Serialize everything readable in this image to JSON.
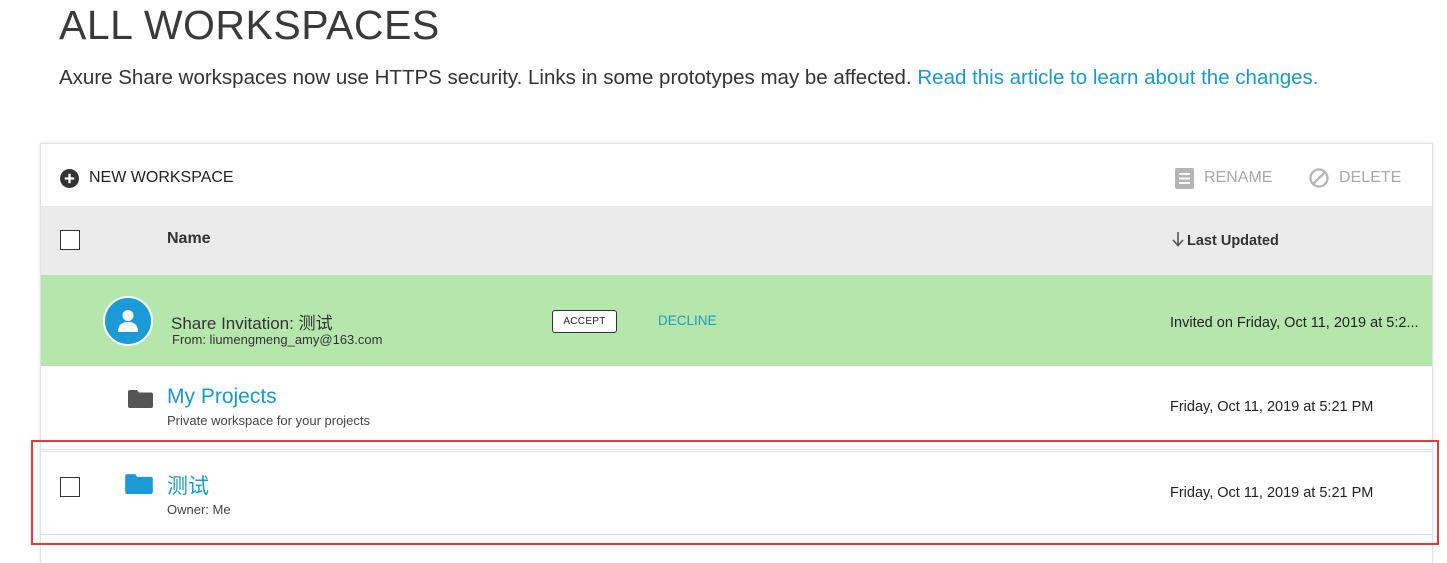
{
  "page": {
    "title": "ALL WORKSPACES",
    "notice_text": "Axure Share workspaces now use HTTPS security. Links in some prototypes may be affected.",
    "notice_link": "Read this article to learn about the changes."
  },
  "toolbar": {
    "new_workspace": "NEW WORKSPACE",
    "rename": "RENAME",
    "delete": "DELETE"
  },
  "table": {
    "header_name": "Name",
    "header_last_updated": "Last Updated",
    "sort_direction": "descending"
  },
  "invitation": {
    "title": "Share Invitation: 测试",
    "from": "From: liumengmeng_amy@163.com",
    "accept_label": "ACCEPT",
    "decline_label": "DECLINE",
    "invited_on": "Invited on Friday, Oct 11, 2019 at 5:2..."
  },
  "workspaces": [
    {
      "name": "My Projects",
      "subtitle": "Private workspace for your projects",
      "updated": "Friday, Oct 11, 2019 at 5:21 PM",
      "icon": "folder-icon",
      "icon_color": "#555555",
      "has_checkbox": false
    },
    {
      "name": "测试",
      "subtitle": "Owner: Me",
      "updated": "Friday, Oct 11, 2019 at 5:21 PM",
      "icon": "folder-icon",
      "icon_color": "#1a9bd7",
      "has_checkbox": true
    }
  ],
  "colors": {
    "accent": "#1a9bc4",
    "invite_bg": "#b5e6ab",
    "header_bg": "#ebebeb",
    "highlight": "#e03c3c"
  }
}
